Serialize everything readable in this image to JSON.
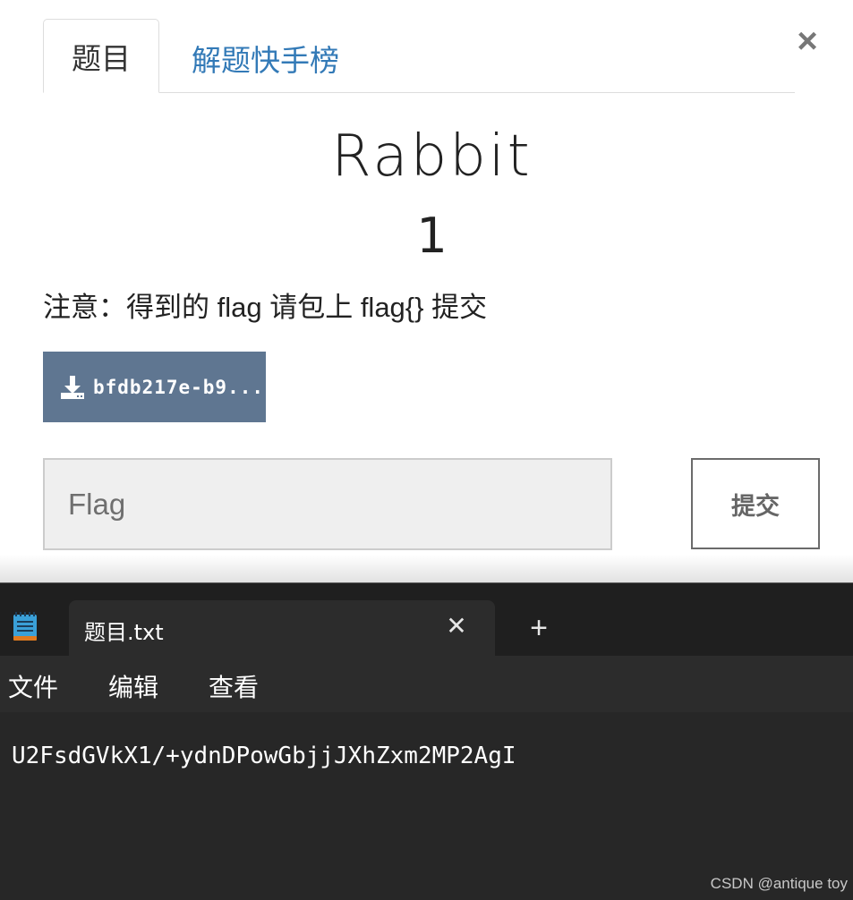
{
  "tabs": [
    {
      "label": "题目",
      "active": true
    },
    {
      "label": "解题快手榜",
      "active": false
    }
  ],
  "close_icon": "close-icon",
  "challenge": {
    "name": "Rabbit",
    "value": "1",
    "description": "注意：得到的 flag 请包上 flag{} 提交",
    "file_label": "bfdb217e-b9...",
    "flag_placeholder": "Flag",
    "submit_label": "提交"
  },
  "notepad": {
    "tab_title": "题目.txt",
    "menu": [
      "文件",
      "编辑",
      "查看"
    ],
    "content": "U2FsdGVkX1/+ydnDPowGbjjJXhZxm2MP2AgI"
  },
  "watermark": "CSDN @antique toy",
  "colors": {
    "link": "#337ab7",
    "download_button": "#5f7691",
    "notepad_bg": "#272727"
  }
}
